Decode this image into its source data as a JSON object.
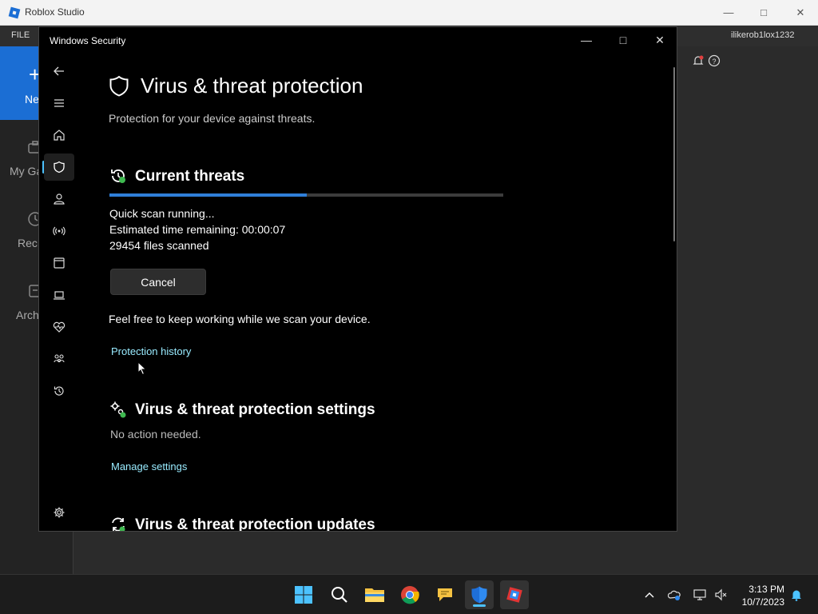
{
  "roblox": {
    "title": "Roblox Studio",
    "menu_file": "FILE",
    "username": "ilikerob1lox1232",
    "sidebar": {
      "new_label": "Ne",
      "items": [
        {
          "label": "My Ga",
          "icon": "briefcase-icon"
        },
        {
          "label": "Rec",
          "icon": "clock-icon"
        },
        {
          "label": "Arch",
          "icon": "archive-icon"
        }
      ]
    }
  },
  "security": {
    "window_title": "Windows Security",
    "page_title": "Virus & threat protection",
    "page_subtitle": "Protection for your device against threats.",
    "current_threats": {
      "title": "Current threats",
      "progress": 0.5,
      "status": "Quick scan running...",
      "time_label": "Estimated time remaining:",
      "time_value": "00:00:07",
      "files_scanned": "29454 files scanned",
      "cancel_label": "Cancel",
      "info": "Feel free to keep working while we scan your device.",
      "history_link": "Protection history"
    },
    "settings": {
      "title": "Virus & threat protection settings",
      "status": "No action needed.",
      "link": "Manage settings"
    },
    "updates": {
      "title": "Virus & threat protection updates"
    },
    "nav": [
      "back-arrow-icon",
      "hamburger-menu-icon",
      "home-icon",
      "shield-icon",
      "account-icon",
      "network-icon",
      "app-browser-icon",
      "device-security-icon",
      "health-icon",
      "family-icon",
      "history-icon",
      "settings-gear-icon"
    ]
  },
  "taskbar": {
    "time": "3:13 PM",
    "date": "10/7/2023",
    "apps": [
      "windows-start-icon",
      "search-icon",
      "file-explorer-icon",
      "chrome-icon",
      "chat-icon",
      "windows-security-icon",
      "roblox-studio-icon"
    ]
  },
  "colors": {
    "accent": "#4cc2ff",
    "progress": "#2f7fd8",
    "link": "#99ebff",
    "roblox_blue": "#1b6ed4"
  }
}
